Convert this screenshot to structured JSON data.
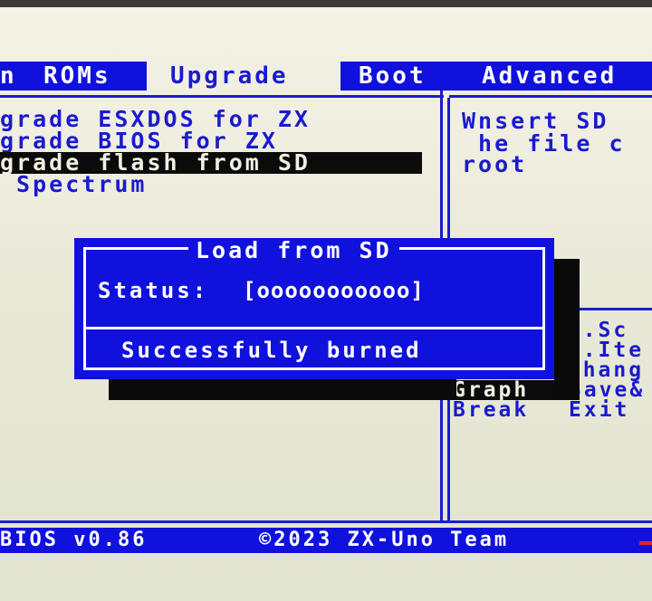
{
  "menu": {
    "items": [
      {
        "label": "n",
        "selected": false
      },
      {
        "label": "ROMs",
        "selected": false
      },
      {
        "label": "Upgrade",
        "selected": true
      },
      {
        "label": "Boot",
        "selected": false
      },
      {
        "label": "Advanced",
        "selected": false
      }
    ]
  },
  "options": {
    "items": [
      {
        "label": "grade ESXDOS for ZX",
        "selected": false
      },
      {
        "label": "grade BIOS for ZX",
        "selected": false
      },
      {
        "label": "grade flash from SD",
        "selected": true
      },
      {
        "label": " Spectrum",
        "selected": false
      }
    ]
  },
  "info": {
    "lines": [
      "Wnsert SD",
      " he file c",
      "root"
    ]
  },
  "dialog": {
    "title": "Load from SD",
    "status_label": "Status:",
    "progress": "[ooooooooooo]",
    "message": "Successfully burned"
  },
  "help": {
    "partial_lines": [
      "el.Sc",
      "el.Ite",
      " Chang"
    ],
    "graph_key": "Graph",
    "graph_action": "Save&",
    "break_key": "Break",
    "break_action": "Exit"
  },
  "status_bar": {
    "version": "BIOS v0.86",
    "copyright": "©2023 ZX-Uno Team"
  },
  "colors": {
    "accent": "#1111dd",
    "background": "#efefdf",
    "highlight": "#0b0b0b"
  }
}
